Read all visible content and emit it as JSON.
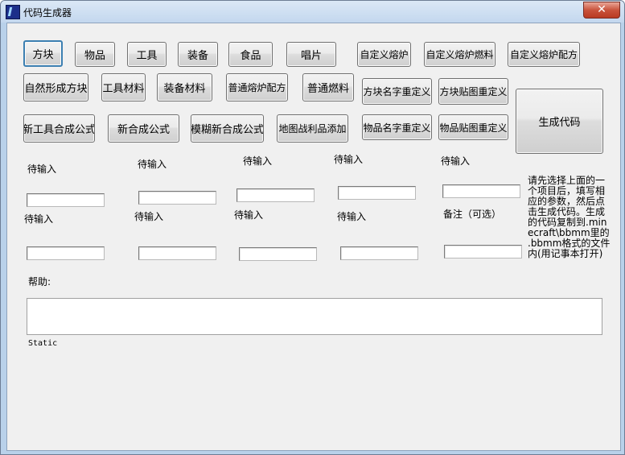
{
  "window": {
    "title": "代码生成器",
    "close_glyph": "✕"
  },
  "buttons_row1": [
    "方块",
    "物品",
    "工具",
    "装备",
    "食品",
    "唱片",
    "自定义熔炉",
    "自定义熔炉燃料",
    "自定义熔炉配方"
  ],
  "buttons_row2": [
    "自然形成方块",
    "工具材料",
    "装备材料",
    "普通熔炉配方",
    "普通燃料",
    "方块名字重定义",
    "方块贴图重定义"
  ],
  "buttons_row3": [
    "新工具合成公式",
    "新合成公式",
    "模糊新合成公式",
    "地图战利品添加",
    "物品名字重定义",
    "物品贴图重定义"
  ],
  "generate_button": "生成代码",
  "labels_row1": [
    "待输入",
    "待输入",
    "待输入",
    "待输入",
    "待输入"
  ],
  "labels_row2": [
    "待输入",
    "待输入",
    "待输入",
    "待输入",
    "备注（可选）"
  ],
  "instructions": "请先选择上面的一个项目后，填写相应的参数，然后点击生成代码。生成的代码复制到.minecraft\\bbmm里的 .bbmm格式的文件内(用记事本打开)",
  "help_label": "帮助:",
  "help_text": "",
  "static_label": "Static"
}
